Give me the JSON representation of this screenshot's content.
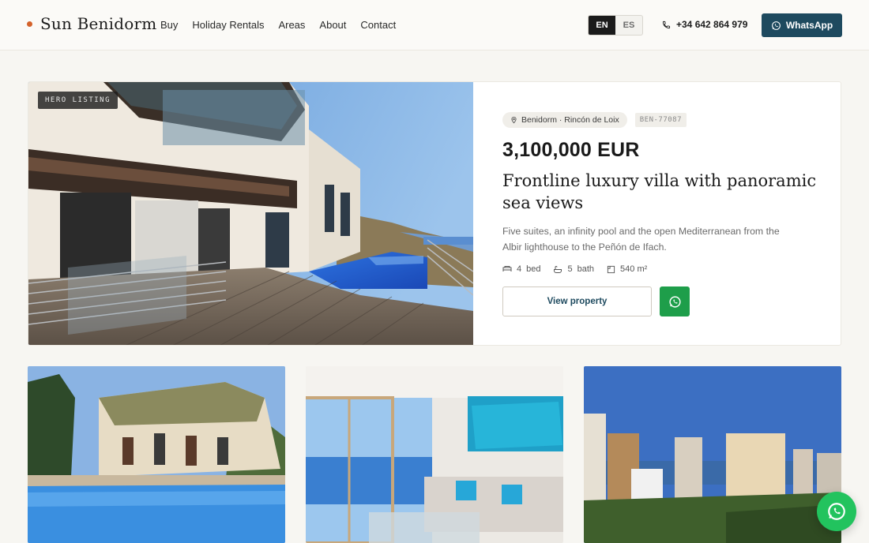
{
  "header": {
    "brand": "Sun Benidorm",
    "nav": [
      "Buy",
      "Holiday Rentals",
      "Areas",
      "About",
      "Contact"
    ],
    "lang": {
      "active": "EN",
      "inactive": "ES"
    },
    "phone": "+34 642 864 979",
    "whatsapp_label": "WhatsApp"
  },
  "hero": {
    "badge": "HERO LISTING",
    "location": "Benidorm · Rincón de Loix",
    "ref": "BEN-77087",
    "price": "3,100,000 EUR",
    "title": "Frontline luxury villa with panoramic sea views",
    "description": "Five suites, an infinity pool and the open Mediterranean from the Albir lighthouse to the Peñón de Ifach.",
    "specs": {
      "beds": "4",
      "beds_label": "bed",
      "baths": "5",
      "baths_label": "bath",
      "area": "540 m²"
    },
    "view_label": "View property"
  },
  "colors": {
    "accent": "#1e4a5f",
    "whatsapp": "#22c35e",
    "brand_dot": "#d4622b"
  },
  "icons": [
    "pin-icon",
    "phone-icon",
    "whatsapp-icon",
    "bed-icon",
    "bath-icon",
    "area-icon"
  ]
}
